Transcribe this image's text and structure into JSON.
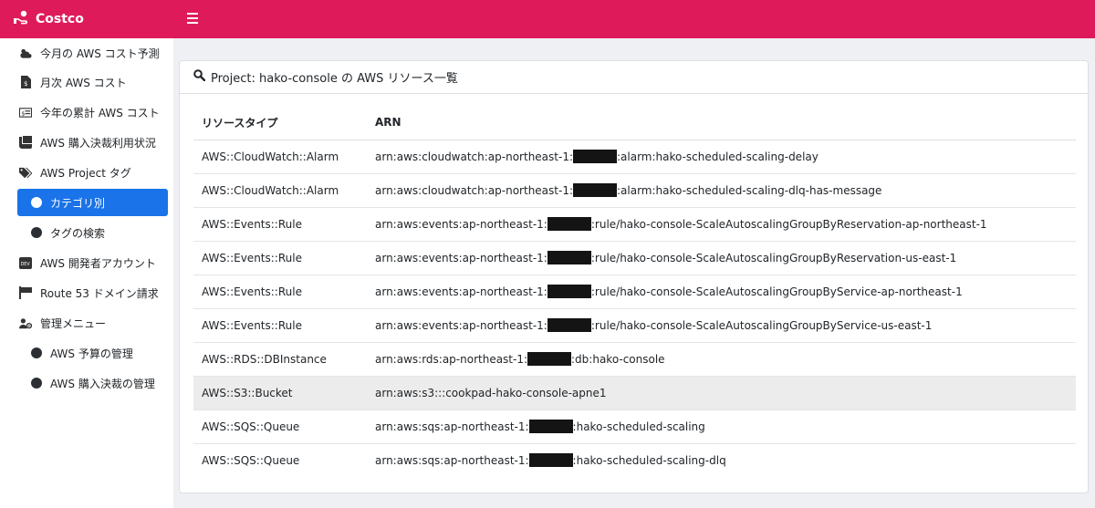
{
  "app": {
    "title": "Costco"
  },
  "sidebar": {
    "items": [
      {
        "label": "今月の AWS コスト予測",
        "icon": "cloud-sun-icon"
      },
      {
        "label": "月次 AWS コスト",
        "icon": "file-invoice-icon"
      },
      {
        "label": "今年の累計 AWS コスト",
        "icon": "money-bill-icon"
      },
      {
        "label": "AWS 購入決裁利用状況",
        "icon": "receipt-icon"
      },
      {
        "label": "AWS Project タグ",
        "icon": "tags-icon"
      },
      {
        "label": "カテゴリ別",
        "icon": "circle-icon",
        "active": true
      },
      {
        "label": "タグの検索",
        "icon": "circle-icon"
      },
      {
        "label": "AWS 開発者アカウント",
        "icon": "dev-icon"
      },
      {
        "label": "Route 53 ドメイン請求",
        "icon": "flag-icon"
      },
      {
        "label": "管理メニュー",
        "icon": "users-cog-icon"
      },
      {
        "label": "AWS 予算の管理",
        "icon": "circle-icon"
      },
      {
        "label": "AWS 購入決裁の管理",
        "icon": "circle-icon"
      }
    ]
  },
  "main": {
    "header": "Project: hako-console の AWS リソース一覧",
    "table": {
      "columns": [
        "リソースタイプ",
        "ARN"
      ],
      "rows": [
        {
          "type": "AWS::CloudWatch::Alarm",
          "arn_prefix": "arn:aws:cloudwatch:ap-northeast-1:",
          "arn_suffix": ":alarm:hako-scheduled-scaling-delay"
        },
        {
          "type": "AWS::CloudWatch::Alarm",
          "arn_prefix": "arn:aws:cloudwatch:ap-northeast-1:",
          "arn_suffix": ":alarm:hako-scheduled-scaling-dlq-has-message"
        },
        {
          "type": "AWS::Events::Rule",
          "arn_prefix": "arn:aws:events:ap-northeast-1:",
          "arn_suffix": ":rule/hako-console-ScaleAutoscalingGroupByReservation-ap-northeast-1"
        },
        {
          "type": "AWS::Events::Rule",
          "arn_prefix": "arn:aws:events:ap-northeast-1:",
          "arn_suffix": ":rule/hako-console-ScaleAutoscalingGroupByReservation-us-east-1"
        },
        {
          "type": "AWS::Events::Rule",
          "arn_prefix": "arn:aws:events:ap-northeast-1:",
          "arn_suffix": ":rule/hako-console-ScaleAutoscalingGroupByService-ap-northeast-1"
        },
        {
          "type": "AWS::Events::Rule",
          "arn_prefix": "arn:aws:events:ap-northeast-1:",
          "arn_suffix": ":rule/hako-console-ScaleAutoscalingGroupByService-us-east-1"
        },
        {
          "type": "AWS::RDS::DBInstance",
          "arn_prefix": "arn:aws:rds:ap-northeast-1:",
          "arn_suffix": ":db:hako-console"
        },
        {
          "type": "AWS::S3::Bucket",
          "arn_prefix": "arn:aws:s3:::cookpad-hako-console-apne1",
          "arn_suffix": ""
        },
        {
          "type": "AWS::SQS::Queue",
          "arn_prefix": "arn:aws:sqs:ap-northeast-1:",
          "arn_suffix": ":hako-scheduled-scaling"
        },
        {
          "type": "AWS::SQS::Queue",
          "arn_prefix": "arn:aws:sqs:ap-northeast-1:",
          "arn_suffix": ":hako-scheduled-scaling-dlq"
        }
      ]
    }
  },
  "colors": {
    "topbar": "#df1a5b",
    "active": "#1a73e8"
  }
}
